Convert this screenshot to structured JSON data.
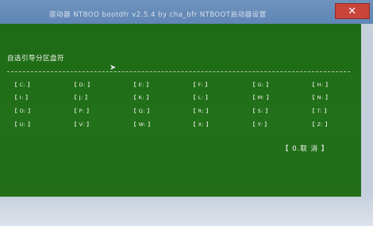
{
  "window": {
    "title": "驱动器  NTBOO bootdfr v2.5.4 by cha_bfr   NTBOOT启动器设置",
    "close_glyph": "✕"
  },
  "prompt": "自选引导分区盘符",
  "drives": [
    "【 C: 】",
    "【 D: 】",
    "【 E: 】",
    "【 F: 】",
    "【 G: 】",
    "【 H: 】",
    "【 I: 】",
    "【 J: 】",
    "【 K: 】",
    "【 L: 】",
    "【 M: 】",
    "【 N: 】",
    "【 O: 】",
    "【 P: 】",
    "【 Q: 】",
    "【 R: 】",
    "【 S: 】",
    "【 T: 】",
    "【 U: 】",
    "【 V: 】",
    "【 W: 】",
    "【 X: 】",
    "【 Y: 】",
    "【 Z: 】"
  ],
  "cancel_label": "【 0.取  消 】",
  "colors": {
    "panel": "#1f6b15",
    "titlebar": "#5f86b5",
    "text": "#f3f6ef"
  },
  "icons": {
    "cursor": "mouse-pointer-icon",
    "close": "close-icon"
  }
}
